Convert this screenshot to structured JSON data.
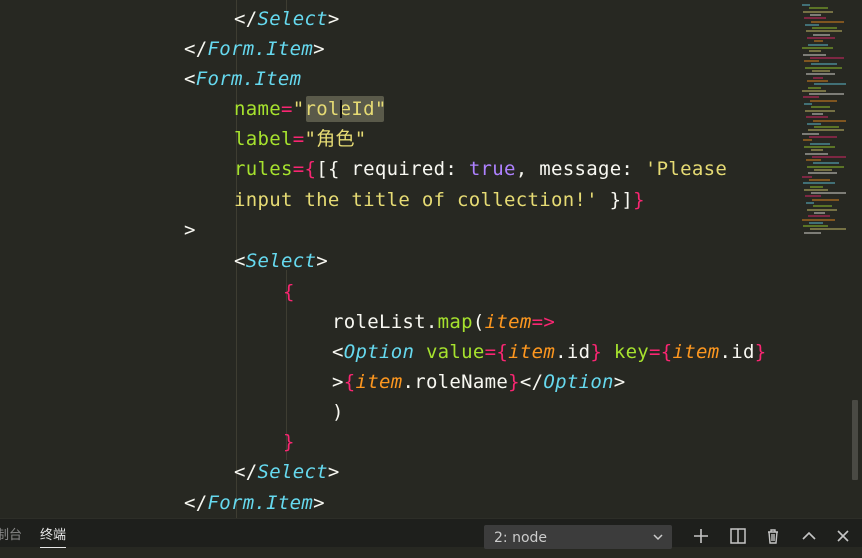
{
  "editor": {
    "code_lines": [
      {
        "tokens": [
          {
            "t": "</",
            "c": "punct"
          },
          {
            "t": "Select",
            "c": "tag"
          },
          {
            "t": ">",
            "c": "punct"
          }
        ]
      },
      {
        "tokens": [
          {
            "t": "</",
            "c": "punct"
          },
          {
            "t": "Form.Item",
            "c": "tag"
          },
          {
            "t": ">",
            "c": "punct"
          }
        ]
      },
      {
        "tokens": [
          {
            "t": "<",
            "c": "punct"
          },
          {
            "t": "Form.Item",
            "c": "tag"
          }
        ]
      },
      {
        "tokens": [
          {
            "t": "name",
            "c": "attr"
          },
          {
            "t": "=",
            "c": "op"
          },
          {
            "t": "\"roleId\"",
            "c": "str"
          }
        ]
      },
      {
        "tokens": [
          {
            "t": "label",
            "c": "attr"
          },
          {
            "t": "=",
            "c": "op"
          },
          {
            "t": "\"角色\"",
            "c": "str"
          }
        ]
      },
      {
        "tokens": [
          {
            "t": "rules",
            "c": "attr"
          },
          {
            "t": "=",
            "c": "op"
          },
          {
            "t": "{",
            "c": "op"
          },
          {
            "t": "[{ required: ",
            "c": "text"
          },
          {
            "t": "true",
            "c": "kw"
          },
          {
            "t": ", message: ",
            "c": "text"
          },
          {
            "t": "'Please",
            "c": "str"
          }
        ]
      },
      {
        "tokens": [
          {
            "t": "input the title of collection!'",
            "c": "str"
          },
          {
            "t": " }]",
            "c": "text"
          },
          {
            "t": "}",
            "c": "op"
          }
        ]
      },
      {
        "tokens": [
          {
            "t": ">",
            "c": "punct"
          }
        ]
      },
      {
        "tokens": [
          {
            "t": "<",
            "c": "punct"
          },
          {
            "t": "Select",
            "c": "tag"
          },
          {
            "t": ">",
            "c": "punct"
          }
        ]
      },
      {
        "tokens": [
          {
            "t": "{",
            "c": "op"
          }
        ]
      },
      {
        "tokens": [
          {
            "t": "roleList.",
            "c": "text"
          },
          {
            "t": "map",
            "c": "fn"
          },
          {
            "t": "(",
            "c": "text"
          },
          {
            "t": "item",
            "c": "var"
          },
          {
            "t": "=>",
            "c": "op"
          }
        ]
      },
      {
        "tokens": [
          {
            "t": "<",
            "c": "punct"
          },
          {
            "t": "Option",
            "c": "tag"
          },
          {
            "t": " ",
            "c": "text"
          },
          {
            "t": "value",
            "c": "attr"
          },
          {
            "t": "=",
            "c": "op"
          },
          {
            "t": "{",
            "c": "op"
          },
          {
            "t": "item",
            "c": "var"
          },
          {
            "t": ".id",
            "c": "text"
          },
          {
            "t": "}",
            "c": "op"
          },
          {
            "t": " ",
            "c": "text"
          },
          {
            "t": "key",
            "c": "attr"
          },
          {
            "t": "=",
            "c": "op"
          },
          {
            "t": "{",
            "c": "op"
          },
          {
            "t": "item",
            "c": "var"
          },
          {
            "t": ".id",
            "c": "text"
          },
          {
            "t": "}",
            "c": "op"
          }
        ]
      },
      {
        "tokens": [
          {
            "t": ">",
            "c": "punct"
          },
          {
            "t": "{",
            "c": "op"
          },
          {
            "t": "item",
            "c": "var"
          },
          {
            "t": ".roleName",
            "c": "text"
          },
          {
            "t": "}",
            "c": "op"
          },
          {
            "t": "</",
            "c": "punct"
          },
          {
            "t": "Option",
            "c": "tag"
          },
          {
            "t": ">",
            "c": "punct"
          }
        ]
      },
      {
        "tokens": [
          {
            "t": ")",
            "c": "text"
          }
        ]
      },
      {
        "tokens": [
          {
            "t": "}",
            "c": "op"
          }
        ]
      },
      {
        "tokens": [
          {
            "t": "</",
            "c": "punct"
          },
          {
            "t": "Select",
            "c": "tag"
          },
          {
            "t": ">",
            "c": "punct"
          }
        ]
      },
      {
        "tokens": [
          {
            "t": "</",
            "c": "punct"
          },
          {
            "t": "Form.Item",
            "c": "tag"
          },
          {
            "t": ">",
            "c": "punct"
          }
        ]
      }
    ],
    "selected_text": "roleId"
  },
  "panel": {
    "tab_console": "制台",
    "tab_terminal": "终端",
    "terminal_select_value": "2: node",
    "icons": [
      "chevron-down-icon",
      "plus-icon",
      "split-icon",
      "trash-icon",
      "chevron-up-icon",
      "close-icon"
    ]
  },
  "colors": {
    "background": "#272822",
    "tag": "#66d9ef",
    "attr": "#a6e22e",
    "string": "#e6db74",
    "operator": "#f92672",
    "keyword": "#ae81ff",
    "variable": "#fd971f"
  }
}
